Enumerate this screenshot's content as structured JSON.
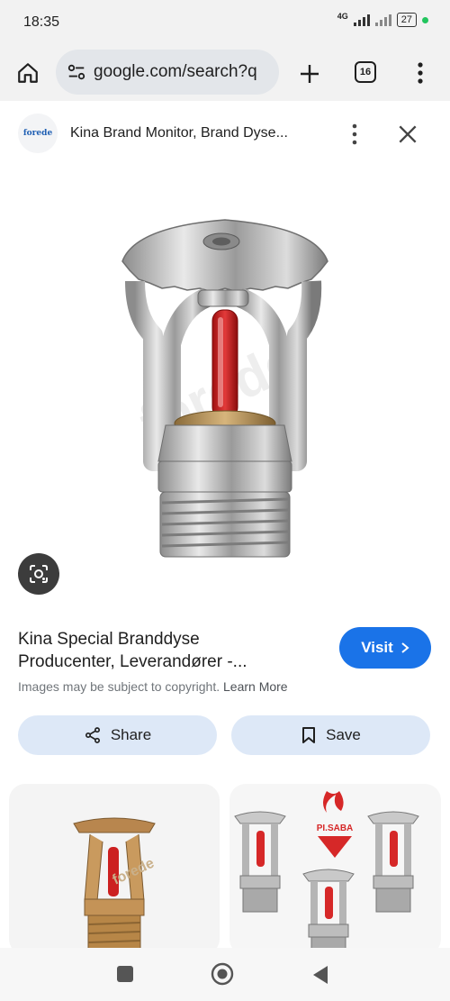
{
  "status": {
    "time": "18:35",
    "network": "4G",
    "battery": "27"
  },
  "browser": {
    "url": "google.com/search?q",
    "tab_count": "16"
  },
  "card": {
    "site_logo_text": "forede",
    "site_title": "Kina Brand Monitor, Brand Dyse...",
    "result_title_line1": "Kina Special Branddyse",
    "result_title_line2": "Producenter, Leverandører -...",
    "visit_label": "Visit",
    "copyright_text": "Images may be subject to copyright.",
    "learn_more": "Learn More",
    "share_label": "Share",
    "save_label": "Save",
    "hero_engraving": "forede",
    "thumb1_logo": "forede",
    "thumb2_brand": "PI.SABA"
  },
  "colors": {
    "accent": "#1a73e8",
    "pill": "#dde8f7",
    "bulb": "#d62828"
  }
}
